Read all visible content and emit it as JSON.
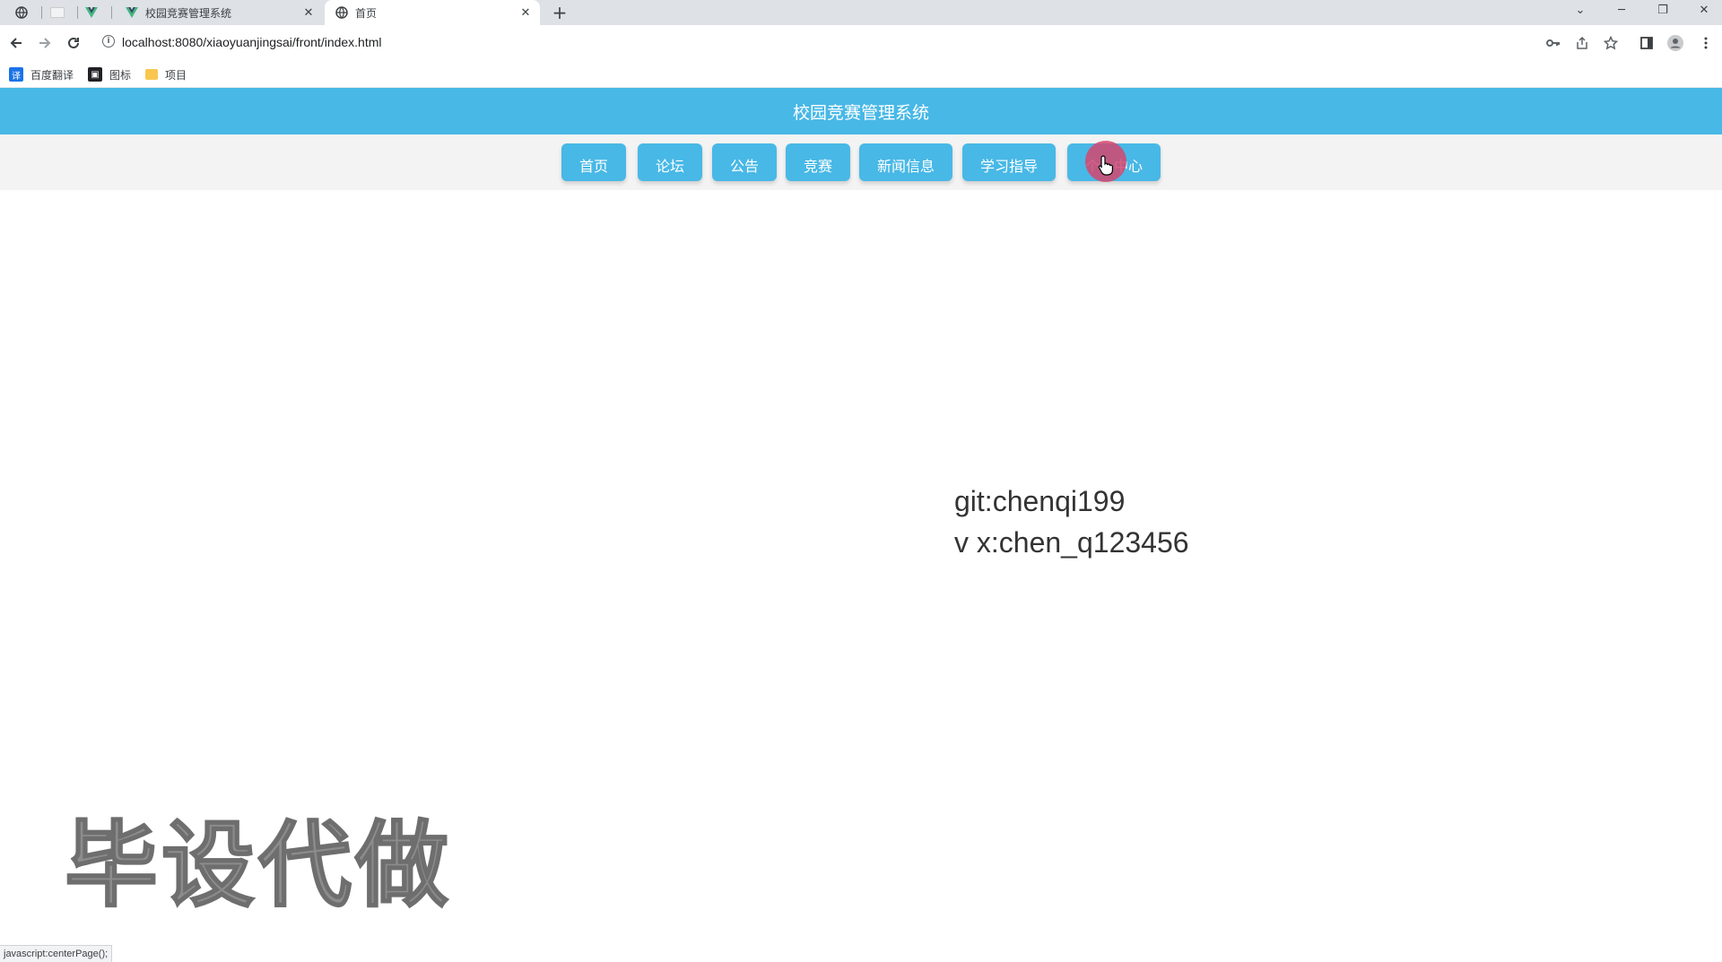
{
  "browser": {
    "tabs": [
      {
        "title": "校园竞赛管理系统",
        "active": false
      },
      {
        "title": "首页",
        "active": true
      }
    ],
    "address": "localhost:8080/xiaoyuanjingsai/front/index.html",
    "bookmarks": [
      {
        "label": "百度翻译",
        "icon": "translate-icon",
        "color": "#1a73e8"
      },
      {
        "label": "图标",
        "icon": "image-icon",
        "color": "#202124"
      },
      {
        "label": "项目",
        "icon": "folder-icon",
        "color": "#f9c74f"
      }
    ],
    "status_text": "javascript:centerPage();"
  },
  "site": {
    "title": "校园竞赛管理系统",
    "brand_color": "#48b8e6",
    "nav": [
      "首页",
      "论坛",
      "公告",
      "竞赛",
      "新闻信息",
      "学习指导",
      "个人中心"
    ]
  },
  "main": {
    "lines": [
      "git:chenqi199",
      "v x:chen_q123456"
    ]
  },
  "overlay": {
    "stamp": "毕设代做"
  }
}
